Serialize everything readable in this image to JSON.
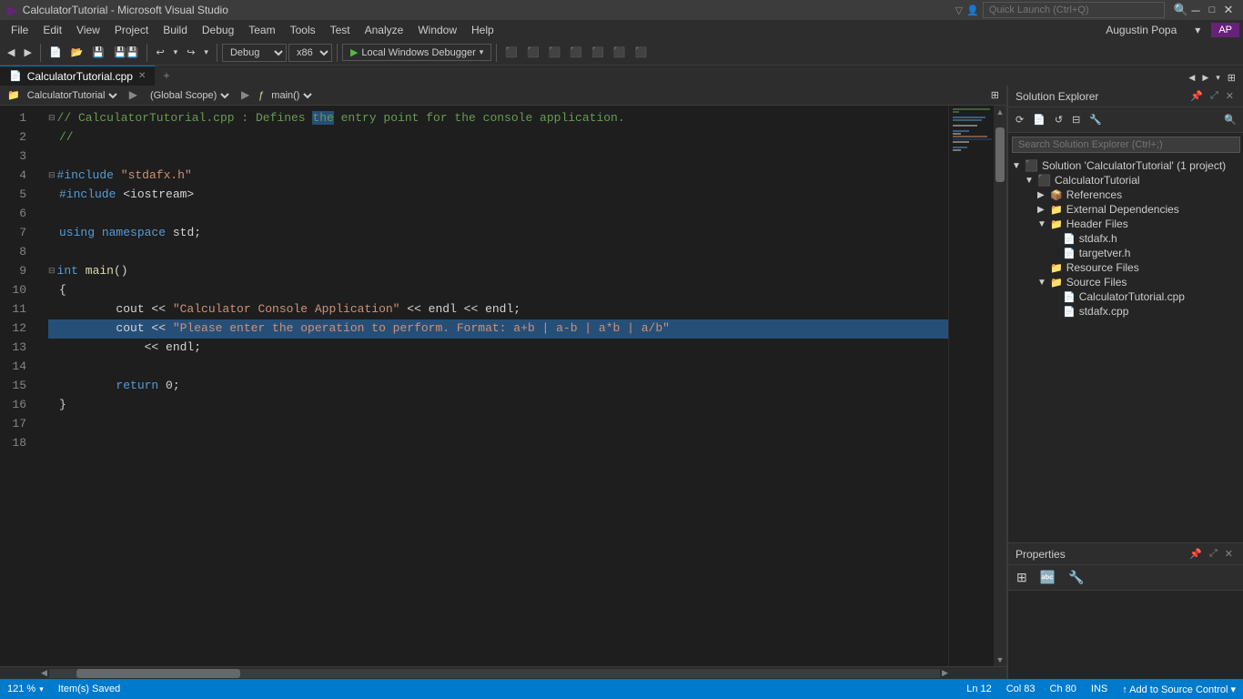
{
  "titleBar": {
    "icon": "VS",
    "title": "CalculatorTutorial - Microsoft Visual Studio",
    "searchPlaceholder": "Quick Launch (Ctrl+Q)",
    "controls": [
      "minimize",
      "maximize",
      "close"
    ]
  },
  "menuBar": {
    "items": [
      "File",
      "Edit",
      "View",
      "Project",
      "Build",
      "Debug",
      "Team",
      "Tools",
      "Test",
      "Analyze",
      "Window",
      "Help"
    ],
    "user": "Augustin Popa",
    "userDropdown": "▾"
  },
  "toolbar": {
    "debugConfig": "Debug",
    "platform": "x86",
    "debugBtn": "▶ Local Windows Debugger"
  },
  "editorTab": {
    "filename": "CalculatorTutorial.cpp",
    "active": true,
    "modified": false
  },
  "editorNav": {
    "projectName": "CalculatorTutorial",
    "scope": "(Global Scope)",
    "symbol": "main()"
  },
  "code": {
    "lines": [
      {
        "num": 1,
        "tokens": [
          {
            "t": "comment",
            "v": "// CalculatorTutorial.cpp : Defines the entry point for the console application."
          }
        ],
        "fold": true
      },
      {
        "num": 2,
        "tokens": [
          {
            "t": "comment",
            "v": "//"
          }
        ]
      },
      {
        "num": 3,
        "tokens": []
      },
      {
        "num": 4,
        "tokens": [
          {
            "t": "preprocessor",
            "v": "#include \"stdafx.h\""
          }
        ],
        "fold": true
      },
      {
        "num": 5,
        "tokens": [
          {
            "t": "preprocessor",
            "v": "#include <iostream>"
          }
        ]
      },
      {
        "num": 6,
        "tokens": []
      },
      {
        "num": 7,
        "tokens": [
          {
            "t": "keyword",
            "v": "using"
          },
          {
            "t": "plain",
            "v": " "
          },
          {
            "t": "keyword",
            "v": "namespace"
          },
          {
            "t": "plain",
            "v": " "
          },
          {
            "t": "plain",
            "v": "std;"
          }
        ]
      },
      {
        "num": 8,
        "tokens": []
      },
      {
        "num": 9,
        "tokens": [
          {
            "t": "fold",
            "v": "⊟"
          },
          {
            "t": "keyword",
            "v": "int"
          },
          {
            "t": "plain",
            "v": " "
          },
          {
            "t": "function",
            "v": "main"
          },
          {
            "t": "plain",
            "v": "()"
          }
        ]
      },
      {
        "num": 10,
        "tokens": [
          {
            "t": "plain",
            "v": "{"
          }
        ]
      },
      {
        "num": 11,
        "tokens": [
          {
            "t": "plain",
            "v": "        cout << "
          },
          {
            "t": "string",
            "v": "\"Calculator Console Application\""
          },
          {
            "t": "plain",
            "v": " << endl << endl;"
          }
        ]
      },
      {
        "num": 12,
        "tokens": [
          {
            "t": "plain",
            "v": "        cout << "
          },
          {
            "t": "string",
            "v": "\"Please enter the operation to perform. Format: a+b | a-b | a*b | a/b\""
          }
        ],
        "highlighted": true
      },
      {
        "num": 13,
        "tokens": [
          {
            "t": "plain",
            "v": "            << endl;"
          }
        ]
      },
      {
        "num": 14,
        "tokens": []
      },
      {
        "num": 15,
        "tokens": [
          {
            "t": "plain",
            "v": "        "
          },
          {
            "t": "keyword",
            "v": "return"
          },
          {
            "t": "plain",
            "v": " 0;"
          }
        ]
      },
      {
        "num": 16,
        "tokens": [
          {
            "t": "plain",
            "v": "}"
          }
        ]
      },
      {
        "num": 17,
        "tokens": []
      },
      {
        "num": 18,
        "tokens": []
      }
    ]
  },
  "solutionExplorer": {
    "title": "Solution Explorer",
    "searchPlaceholder": "Search Solution Explorer (Ctrl+;)",
    "tree": [
      {
        "level": 0,
        "type": "solution",
        "label": "Solution 'CalculatorTutorial' (1 project)",
        "expanded": true,
        "icon": "solution"
      },
      {
        "level": 1,
        "type": "project",
        "label": "CalculatorTutorial",
        "expanded": true,
        "icon": "project"
      },
      {
        "level": 2,
        "type": "folder",
        "label": "References",
        "expanded": false,
        "icon": "refs",
        "arrow": "▶"
      },
      {
        "level": 2,
        "type": "folder",
        "label": "External Dependencies",
        "expanded": false,
        "icon": "folder",
        "arrow": "▶"
      },
      {
        "level": 2,
        "type": "folder",
        "label": "Header Files",
        "expanded": true,
        "icon": "folder",
        "arrow": "▼"
      },
      {
        "level": 3,
        "type": "file",
        "label": "stdafx.h",
        "icon": "file-h"
      },
      {
        "level": 3,
        "type": "file",
        "label": "targetver.h",
        "icon": "file-h"
      },
      {
        "level": 2,
        "type": "folder",
        "label": "Resource Files",
        "expanded": false,
        "icon": "folder"
      },
      {
        "level": 2,
        "type": "folder",
        "label": "Source Files",
        "expanded": true,
        "icon": "folder",
        "arrow": "▼"
      },
      {
        "level": 3,
        "type": "file",
        "label": "CalculatorTutorial.cpp",
        "icon": "file-cpp"
      },
      {
        "level": 3,
        "type": "file",
        "label": "stdafx.cpp",
        "icon": "file-cpp"
      }
    ]
  },
  "properties": {
    "title": "Properties"
  },
  "statusBar": {
    "item1": "Item(s) Saved",
    "ln": "Ln 12",
    "col": "Col 83",
    "ch": "Ch 80",
    "mode": "INS",
    "sourceControl": "↑ Add to Source Control ▾",
    "zoom": "121 %"
  }
}
